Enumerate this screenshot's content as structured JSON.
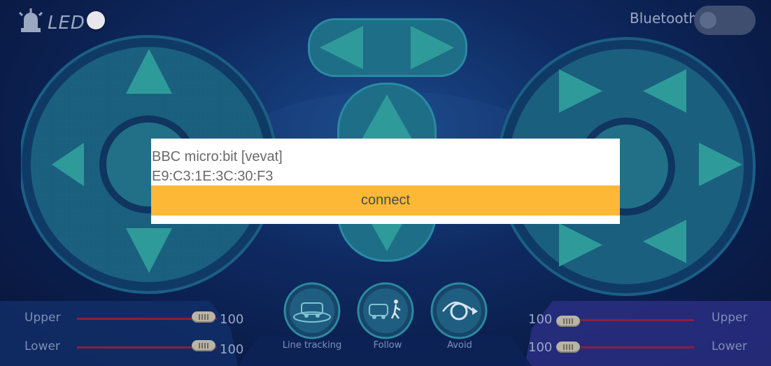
{
  "header": {
    "led_label": "LED",
    "bluetooth_label": "Bluetooth",
    "led_on": false,
    "bluetooth_on": false
  },
  "left_sliders": [
    {
      "label": "Upper",
      "value": "100"
    },
    {
      "label": "Lower",
      "value": "100"
    }
  ],
  "right_sliders": [
    {
      "label": "Upper",
      "value": "100"
    },
    {
      "label": "Lower",
      "value": "100"
    }
  ],
  "modes": [
    {
      "label": "Line tracking",
      "icon": "car-line-tracking-icon"
    },
    {
      "label": "Follow",
      "icon": "car-follow-icon"
    },
    {
      "label": "Avoid",
      "icon": "obstacle-avoid-icon"
    }
  ],
  "dialog": {
    "device_name": "BBC micro:bit [vevat]",
    "device_mac": "E9:C3:1E:3C:30:F3",
    "connect_label": "connect"
  },
  "colors": {
    "accent_connect": "#fdb935",
    "pad": "#2a8a9a",
    "slider_track": "#8a1f3e",
    "background": "#0f2a62"
  }
}
